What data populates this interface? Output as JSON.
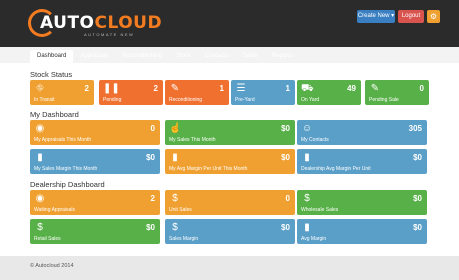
{
  "brand": {
    "name_a": "AUTO",
    "name_b": "CLOUD",
    "tagline": "AUTOMATE NEW"
  },
  "header_buttons": {
    "create_new": "Create New ▾",
    "logout": "Logout",
    "gear_icon": "gear-icon"
  },
  "nav": [
    "Dashboard",
    "Appraisals",
    "Reconditioning",
    "Stock",
    "Contacts",
    "Sales",
    "Reports"
  ],
  "sections": {
    "stock_status": "Stock Status",
    "my_dashboard": "My Dashboard",
    "dealership_dashboard": "Dealership Dashboard"
  },
  "stock_status": [
    {
      "label": "In Transit",
      "value": "2",
      "icon": "road-icon",
      "color": "orange"
    },
    {
      "label": "Pending",
      "value": "2",
      "icon": "pause-icon",
      "color": "red"
    },
    {
      "label": "Reconditioning",
      "value": "1",
      "icon": "wrench-icon",
      "color": "red"
    },
    {
      "label": "Pre-Yard",
      "value": "1",
      "icon": "list-icon",
      "color": "blue"
    },
    {
      "label": "On Yard",
      "value": "49",
      "icon": "car-icon",
      "color": "green"
    },
    {
      "label": "Pending Sale",
      "value": "0",
      "icon": "pencil-icon",
      "color": "green"
    }
  ],
  "my_dashboard": [
    {
      "label": "My Appraisals This Month",
      "value": "0",
      "icon": "eye-icon",
      "color": "orange"
    },
    {
      "label": "My Sales This Month",
      "value": "$0",
      "icon": "thumbs-up-icon",
      "color": "green"
    },
    {
      "label": "My Contacts",
      "value": "305",
      "icon": "user-icon",
      "color": "blue"
    },
    {
      "label": "My Sales Margin This Month",
      "value": "$0",
      "icon": "bar-chart-icon",
      "color": "blue"
    },
    {
      "label": "My Avg Margin Per Unit This Month",
      "value": "$0",
      "icon": "bar-chart-icon",
      "color": "orange"
    },
    {
      "label": "Dealership Avg Margin Per Unit",
      "value": "$0",
      "icon": "bar-chart-icon",
      "color": "blue"
    }
  ],
  "dealership_dashboard": [
    {
      "label": "Waiting Appraisals",
      "value": "2",
      "icon": "eye-icon",
      "color": "orange"
    },
    {
      "label": "Unit Sales",
      "value": "0",
      "icon": "dollar-icon",
      "color": "orange"
    },
    {
      "label": "Wholesale Sales",
      "value": "$0",
      "icon": "dollar-icon",
      "color": "green"
    },
    {
      "label": "Retail Sales",
      "value": "$0",
      "icon": "dollar-icon",
      "color": "green"
    },
    {
      "label": "Sales Margin",
      "value": "$0",
      "icon": "dollar-icon",
      "color": "blue"
    },
    {
      "label": "Avg Margin",
      "value": "$0",
      "icon": "bar-chart-icon",
      "color": "blue"
    }
  ],
  "footer": "© Autocloud 2014"
}
